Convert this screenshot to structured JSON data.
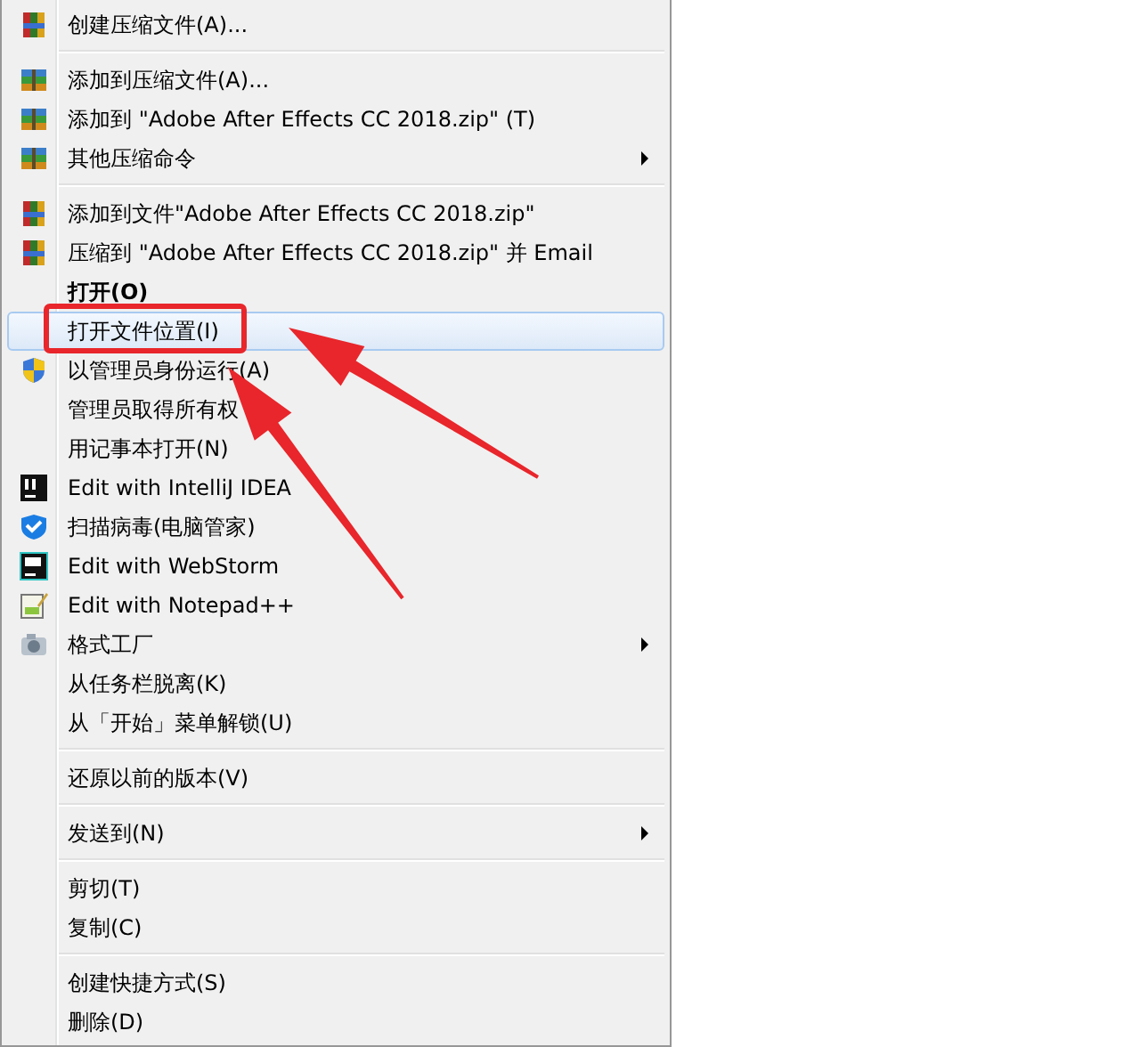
{
  "context_menu": {
    "groups": [
      [
        {
          "label": "创建压缩文件(A)...",
          "default": false,
          "hovered": false,
          "submenu": false
        }
      ],
      [
        {
          "label": "添加到压缩文件(A)...",
          "default": false,
          "hovered": false,
          "submenu": false
        },
        {
          "label": "添加到 \"Adobe After Effects CC 2018.zip\" (T)",
          "default": false,
          "hovered": false,
          "submenu": false
        },
        {
          "label": "其他压缩命令",
          "default": false,
          "hovered": false,
          "submenu": true
        }
      ],
      [
        {
          "label": "添加到文件\"Adobe After Effects CC 2018.zip\"",
          "default": false,
          "hovered": false,
          "submenu": false
        },
        {
          "label": "压缩到 \"Adobe After Effects CC 2018.zip\" 并 Email",
          "default": false,
          "hovered": false,
          "submenu": false
        },
        {
          "label": "打开(O)",
          "default": true,
          "hovered": false,
          "submenu": false
        },
        {
          "label": "打开文件位置(I)",
          "default": false,
          "hovered": true,
          "submenu": false
        },
        {
          "label": "以管理员身份运行(A)",
          "default": false,
          "hovered": false,
          "submenu": false
        },
        {
          "label": "管理员取得所有权",
          "default": false,
          "hovered": false,
          "submenu": false
        },
        {
          "label": "用记事本打开(N)",
          "default": false,
          "hovered": false,
          "submenu": false
        },
        {
          "label": "Edit with IntelliJ IDEA",
          "default": false,
          "hovered": false,
          "submenu": false
        },
        {
          "label": "扫描病毒(电脑管家)",
          "default": false,
          "hovered": false,
          "submenu": false
        },
        {
          "label": "Edit with WebStorm",
          "default": false,
          "hovered": false,
          "submenu": false
        },
        {
          "label": "Edit with Notepad++",
          "default": false,
          "hovered": false,
          "submenu": false
        },
        {
          "label": "格式工厂",
          "default": false,
          "hovered": false,
          "submenu": true
        },
        {
          "label": "从任务栏脱离(K)",
          "default": false,
          "hovered": false,
          "submenu": false
        },
        {
          "label": "从「开始」菜单解锁(U)",
          "default": false,
          "hovered": false,
          "submenu": false
        }
      ],
      [
        {
          "label": "还原以前的版本(V)",
          "default": false,
          "hovered": false,
          "submenu": false
        }
      ],
      [
        {
          "label": "发送到(N)",
          "default": false,
          "hovered": false,
          "submenu": true
        }
      ],
      [
        {
          "label": "剪切(T)",
          "default": false,
          "hovered": false,
          "submenu": false
        },
        {
          "label": "复制(C)",
          "default": false,
          "hovered": false,
          "submenu": false
        }
      ],
      [
        {
          "label": "创建快捷方式(S)",
          "default": false,
          "hovered": false,
          "submenu": false
        },
        {
          "label": "删除(D)",
          "default": false,
          "hovered": false,
          "submenu": false
        }
      ]
    ]
  }
}
